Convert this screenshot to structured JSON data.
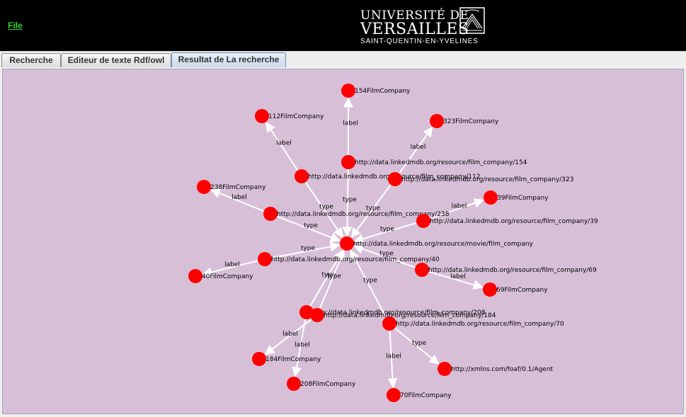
{
  "menu": {
    "file_label": "File"
  },
  "logo": {
    "line1": "UNIVERSITÉ DE",
    "line2": "VERSAILLES",
    "line3": "SAINT-QUENTIN-EN-YVELINES"
  },
  "tabs": [
    {
      "label": "Recherche",
      "active": false
    },
    {
      "label": "Editeur de texte Rdf/owl",
      "active": false
    },
    {
      "label": "Resultat de La recherche",
      "active": true
    }
  ],
  "graph": {
    "node_color": "#ff0000",
    "edge_color": "#ffffff",
    "background_color": "#d8bfd8",
    "nodes": [
      {
        "id": "center",
        "label": "http://data.linkedmdb.org/resource/movie/film_company"
      },
      {
        "id": "fc154",
        "label": "http://data.linkedmdb.org/resource/film_company/154"
      },
      {
        "id": "fc112",
        "label": "http://data.linkedmdb.org/resource/film_company/112"
      },
      {
        "id": "fc323",
        "label": "http://data.linkedmdb.org/resource/film_company/323"
      },
      {
        "id": "fc238",
        "label": "http://data.linkedmdb.org/resource/film_company/238"
      },
      {
        "id": "fc39",
        "label": "http://data.linkedmdb.org/resource/film_company/39"
      },
      {
        "id": "fc40",
        "label": "http://data.linkedmdb.org/resource/film_company/40"
      },
      {
        "id": "fc69",
        "label": "http://data.linkedmdb.org/resource/film_company/69"
      },
      {
        "id": "fc208",
        "label": "http://data.linkedmdb.org/resource/film_company/208"
      },
      {
        "id": "fc184",
        "label": "http://data.linkedmdb.org/resource/film_company/184"
      },
      {
        "id": "fc70",
        "label": "http://data.linkedmdb.org/resource/film_company/70"
      },
      {
        "id": "agent",
        "label": "http://xmlns.com/foaf/0.1/Agent"
      },
      {
        "id": "l154",
        "label": "154FilmCompany"
      },
      {
        "id": "l112",
        "label": "112FilmCompany"
      },
      {
        "id": "l323",
        "label": "323FilmCompany"
      },
      {
        "id": "l238",
        "label": "238FilmCompany"
      },
      {
        "id": "l39",
        "label": "39FilmCompany"
      },
      {
        "id": "l40",
        "label": "40FilmCompany"
      },
      {
        "id": "l69",
        "label": "69FilmCompany"
      },
      {
        "id": "l184",
        "label": "184FilmCompany"
      },
      {
        "id": "l208",
        "label": "208FilmCompany"
      },
      {
        "id": "l70",
        "label": "70FilmCompany"
      }
    ],
    "edges": [
      {
        "from": "fc154",
        "to": "center",
        "label": "type"
      },
      {
        "from": "fc112",
        "to": "center",
        "label": "type"
      },
      {
        "from": "fc323",
        "to": "center",
        "label": "type"
      },
      {
        "from": "fc238",
        "to": "center",
        "label": "type"
      },
      {
        "from": "fc39",
        "to": "center",
        "label": "type"
      },
      {
        "from": "fc40",
        "to": "center",
        "label": "type"
      },
      {
        "from": "fc69",
        "to": "center",
        "label": "type"
      },
      {
        "from": "fc208",
        "to": "center",
        "label": "type"
      },
      {
        "from": "fc184",
        "to": "center",
        "label": "type"
      },
      {
        "from": "fc70",
        "to": "center",
        "label": "type"
      },
      {
        "from": "fc70",
        "to": "agent",
        "label": "type"
      },
      {
        "from": "fc154",
        "to": "l154",
        "label": "label"
      },
      {
        "from": "fc112",
        "to": "l112",
        "label": "label"
      },
      {
        "from": "fc323",
        "to": "l323",
        "label": "label"
      },
      {
        "from": "fc238",
        "to": "l238",
        "label": "label"
      },
      {
        "from": "fc39",
        "to": "l39",
        "label": "label"
      },
      {
        "from": "fc40",
        "to": "l40",
        "label": "label"
      },
      {
        "from": "fc69",
        "to": "l69",
        "label": "label"
      },
      {
        "from": "fc184",
        "to": "l184",
        "label": "label"
      },
      {
        "from": "fc208",
        "to": "l208",
        "label": "label"
      },
      {
        "from": "fc70",
        "to": "l70",
        "label": "label"
      }
    ]
  }
}
